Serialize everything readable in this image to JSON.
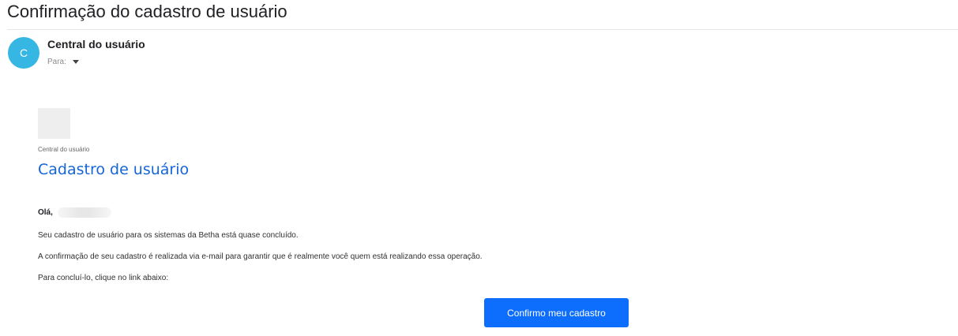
{
  "email": {
    "subject": "Confirmação do cadastro de usuário",
    "sender": {
      "initial": "C",
      "name": "Central do usuário",
      "to_label": "Para:",
      "avatar_color": "#35b6e3"
    },
    "body": {
      "header_sub": "Central do usuário",
      "header_title": "Cadastro de usuário",
      "greeting": "Olá,",
      "paragraphs": [
        "Seu cadastro de usuário para os sistemas da Betha está quase concluído.",
        "A confirmação de seu cadastro é realizada via e-mail para garantir que é realmente você quem está realizando essa operação.",
        "Para concluí-lo, clique no link abaixo:"
      ],
      "cta_label": "Confirmo meu cadastro"
    }
  },
  "colors": {
    "accent": "#1565d8",
    "button": "#0d6efd"
  }
}
